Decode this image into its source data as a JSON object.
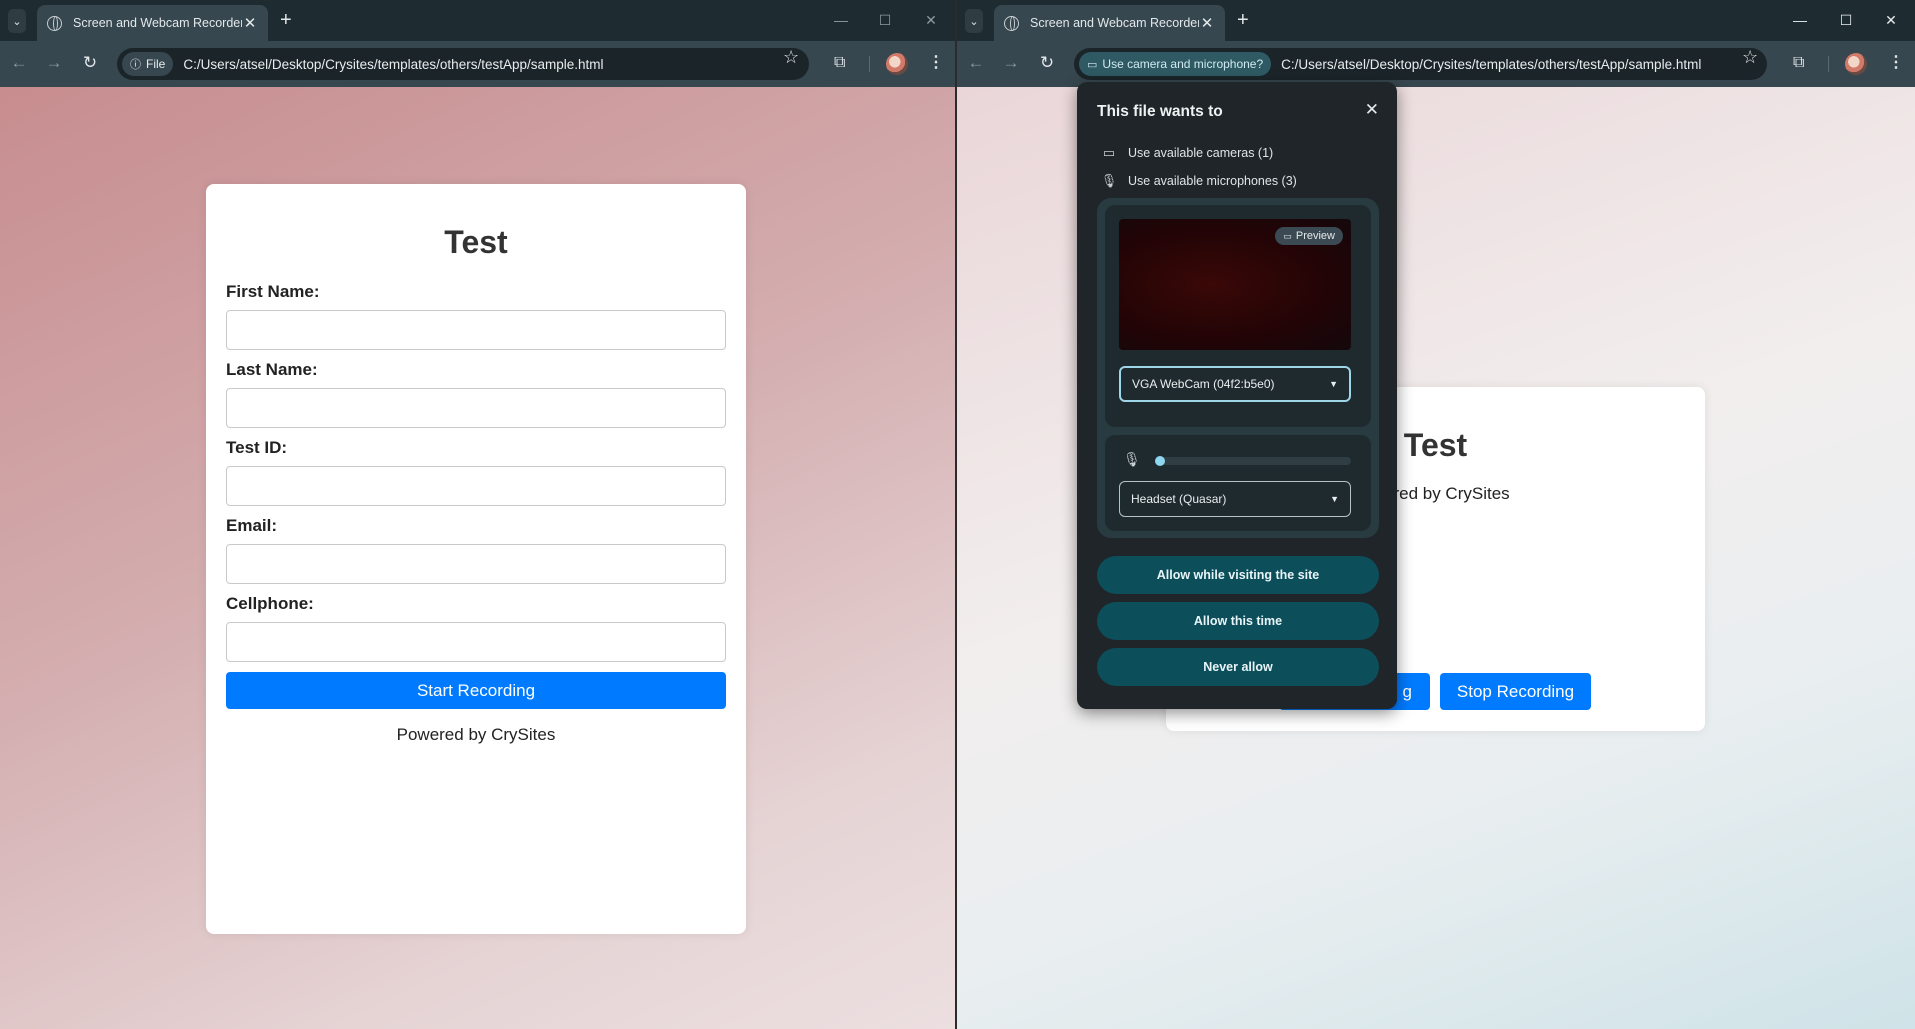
{
  "browser_left": {
    "tab_title": "Screen and Webcam Recorder",
    "site_chip_label": "File",
    "url": "C:/Users/atsel/Desktop/Crysites/templates/others/testApp/sample.html"
  },
  "browser_right": {
    "tab_title": "Screen and Webcam Recorder",
    "permission_chip_label": "Use camera and microphone?",
    "url": "C:/Users/atsel/Desktop/Crysites/templates/others/testApp/sample.html"
  },
  "form_page": {
    "title": "Test",
    "fields": [
      {
        "label": "First Name:",
        "value": ""
      },
      {
        "label": "Last Name:",
        "value": ""
      },
      {
        "label": "Test ID:",
        "value": ""
      },
      {
        "label": "Email:",
        "value": ""
      },
      {
        "label": "Cellphone:",
        "value": ""
      }
    ],
    "start_button": "Start Recording",
    "footer": "Powered by CrySites"
  },
  "recording_page": {
    "title": "Test",
    "footer_partial": "ered by CrySites",
    "start_button_partial": "g",
    "stop_button": "Stop Recording"
  },
  "permission_popup": {
    "title": "This file wants to",
    "permissions": [
      {
        "label": "Use available cameras (1)",
        "icon": "camera-icon"
      },
      {
        "label": "Use available microphones (3)",
        "icon": "microphone-icon"
      }
    ],
    "preview_label": "Preview",
    "camera_select": "VGA WebCam (04f2:b5e0)",
    "mic_level": 0.02,
    "microphone_select": "Headset (Quasar)",
    "buttons": [
      "Allow while visiting the site",
      "Allow this time",
      "Never allow"
    ]
  },
  "colors": {
    "accent_blue": "#007bff",
    "permission_button": "#0c4e5a",
    "browser_chrome": "#37474f",
    "titlebar": "#1e2b30",
    "popup_bg": "#1f2529",
    "mic_level": "#8fd6f0"
  }
}
